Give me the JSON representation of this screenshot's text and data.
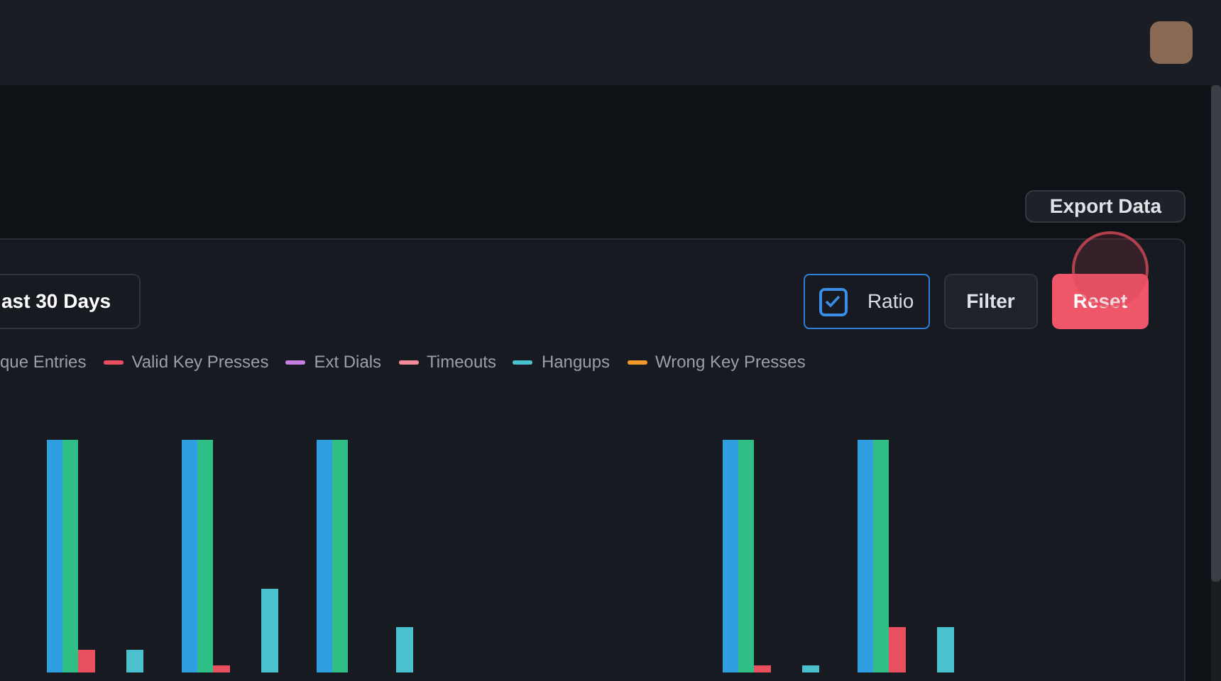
{
  "export_button": "Export Data",
  "panel": {
    "date_range": "ast 30 Days",
    "ratio": {
      "label": "Ratio",
      "checked": true
    },
    "buttons": [
      {
        "label": "Filter",
        "kind": "plain"
      },
      {
        "label": "Reset",
        "kind": "danger"
      }
    ],
    "legend": [
      {
        "label": "que Entries"
      },
      {
        "label": "Valid Key Presses",
        "color": "#e8505f"
      },
      {
        "label": "Ext Dials",
        "color": "#c47fe0"
      },
      {
        "label": "Timeouts",
        "color": "#f38b98"
      },
      {
        "label": "Hangups",
        "color": "#4ac1cc"
      },
      {
        "label": "Wrong Key Presses",
        "color": "#f3992a"
      }
    ]
  }
}
